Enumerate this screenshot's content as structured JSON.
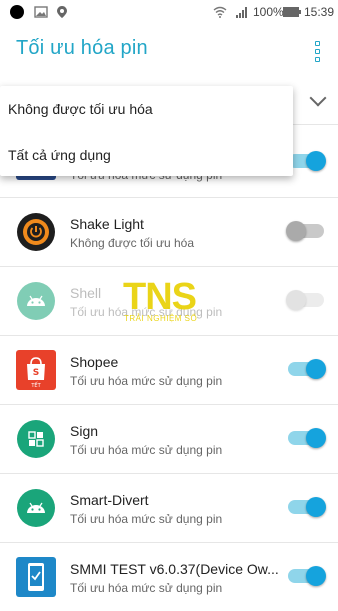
{
  "status_bar": {
    "battery": "100%",
    "time": "15:39"
  },
  "app_bar": {
    "title": "Tối ưu hóa pin"
  },
  "dropdown": {
    "items": [
      {
        "label": "Không được tối ưu hóa"
      },
      {
        "label": "Tất cả ứng dụng"
      }
    ]
  },
  "partial_row": {
    "sub": "Tối ưu hóa mức sử dụng pin",
    "toggle_on": true
  },
  "apps": [
    {
      "name": "Shake Light",
      "sub": "Không được tối ưu hóa",
      "toggle_on": false,
      "disabled": false,
      "icon": "flashlight-icon"
    },
    {
      "name": "Shell",
      "sub": "Tối ưu hóa mức sử dụng pin",
      "toggle_on": false,
      "disabled": true,
      "icon": "android-icon"
    },
    {
      "name": "Shopee",
      "sub": "Tối ưu hóa mức sử dụng pin",
      "toggle_on": true,
      "disabled": false,
      "icon": "shopee-bag-icon"
    },
    {
      "name": "Sign",
      "sub": "Tối ưu hóa mức sử dụng pin",
      "toggle_on": true,
      "disabled": false,
      "icon": "sign-icon"
    },
    {
      "name": "Smart-Divert",
      "sub": "Tối ưu hóa mức sử dụng pin",
      "toggle_on": true,
      "disabled": false,
      "icon": "android-icon"
    },
    {
      "name": "SMMI TEST v6.0.37(Device Ow...",
      "sub": "Tối ưu hóa mức sử dụng pin",
      "toggle_on": true,
      "disabled": false,
      "icon": "phone-check-icon"
    }
  ],
  "watermark": {
    "letters": "TNS",
    "sub": "TRẢI NGHIỆM SỐ"
  },
  "colors": {
    "accent": "#22a6c7",
    "toggle_on": "#15a3dd",
    "android_green": "#1aa57a",
    "shopee_red": "#e8412a"
  }
}
